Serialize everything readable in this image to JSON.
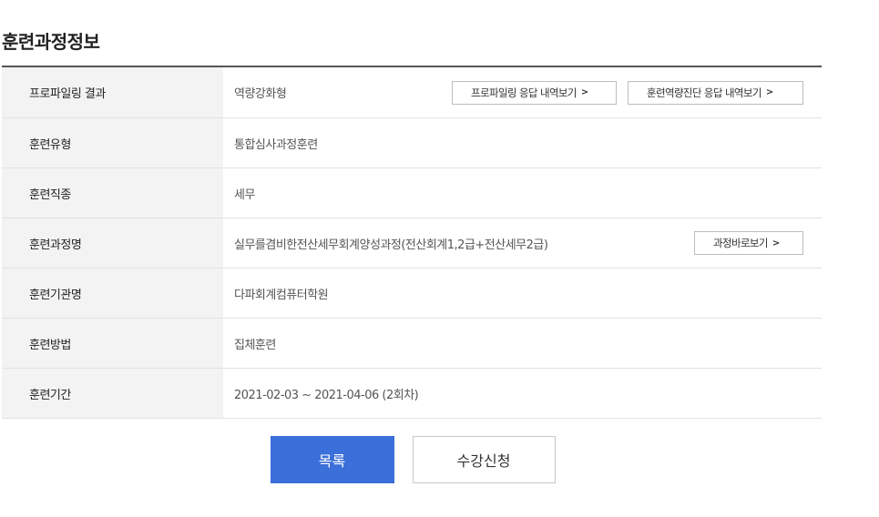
{
  "title": "훈련과정정보",
  "rows": [
    {
      "label": "프로파일링 결과",
      "value": "역량강화형"
    },
    {
      "label": "훈련유형",
      "value": "통합심사과정훈련"
    },
    {
      "label": "훈련직종",
      "value": "세무"
    },
    {
      "label": "훈련과정명",
      "value": "실무를겸비한전산세무회계양성과정(전산회계1,2급+전산세무2급)"
    },
    {
      "label": "훈련기관명",
      "value": "다파회계컴퓨터학원"
    },
    {
      "label": "훈련방법",
      "value": "집체훈련"
    },
    {
      "label": "훈련기간",
      "value": "2021-02-03 ~ 2021-04-06 (2회차)"
    }
  ],
  "buttons": {
    "profile_answers": "프로파일링 응답 내역보기",
    "diagnosis_answers": "훈련역량진단 응답 내역보기",
    "course_shortcut": "과정바로보기",
    "list": "목록",
    "apply": "수강신청"
  },
  "icons": {
    "chevron": "chevron-right-icon"
  },
  "colors": {
    "primary": "#3b6fd9",
    "header_bg": "#f3f3f3"
  }
}
